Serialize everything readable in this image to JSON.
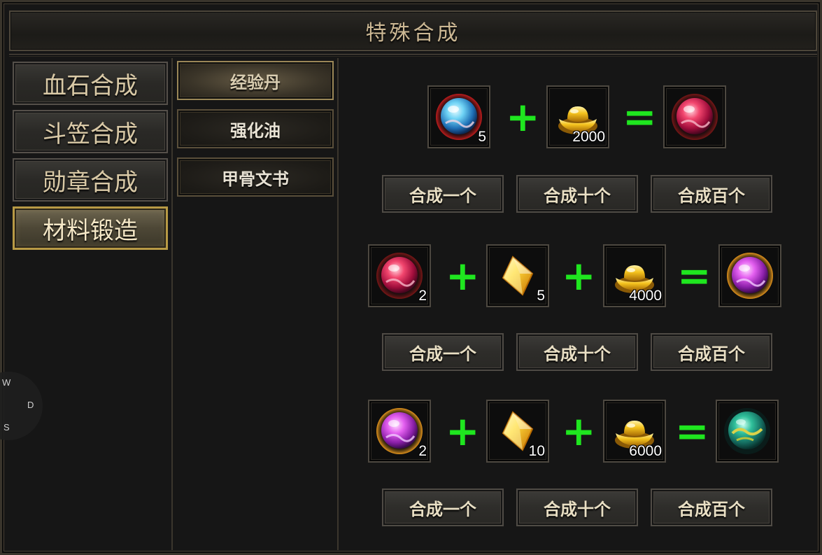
{
  "title": "特殊合成",
  "categories": [
    {
      "label": "血石合成",
      "active": false
    },
    {
      "label": "斗笠合成",
      "active": false
    },
    {
      "label": "勋章合成",
      "active": false
    },
    {
      "label": "材料锻造",
      "active": true
    }
  ],
  "subcategories": [
    {
      "label": "经验丹",
      "active": true
    },
    {
      "label": "强化油",
      "active": false
    },
    {
      "label": "甲骨文书",
      "active": false
    }
  ],
  "recipes": [
    {
      "inputs": [
        {
          "icon": "blue-orb-icon",
          "qty": "5"
        },
        {
          "icon": "gold-ingot-icon",
          "qty": "2000"
        }
      ],
      "output": {
        "icon": "red-orb-icon"
      },
      "actions": [
        "合成一个",
        "合成十个",
        "合成百个"
      ]
    },
    {
      "inputs": [
        {
          "icon": "red-orb-icon",
          "qty": "2"
        },
        {
          "icon": "gold-crystal-icon",
          "qty": "5"
        },
        {
          "icon": "gold-ingot-icon",
          "qty": "4000"
        }
      ],
      "output": {
        "icon": "purple-orb-icon"
      },
      "actions": [
        "合成一个",
        "合成十个",
        "合成百个"
      ]
    },
    {
      "inputs": [
        {
          "icon": "purple-orb-icon",
          "qty": "2"
        },
        {
          "icon": "gold-crystal-icon",
          "qty": "10"
        },
        {
          "icon": "gold-ingot-icon",
          "qty": "6000"
        }
      ],
      "output": {
        "icon": "green-jade-orb-icon"
      },
      "actions": [
        "合成一个",
        "合成十个",
        "合成百个"
      ]
    }
  ],
  "operators": {
    "plus": "+",
    "equals": "="
  },
  "joystick": {
    "w": "W",
    "d": "D",
    "s": "S"
  },
  "colors": {
    "operator": "#1fe61f",
    "active_border": "#b89a45",
    "title_text": "#cbb793"
  }
}
